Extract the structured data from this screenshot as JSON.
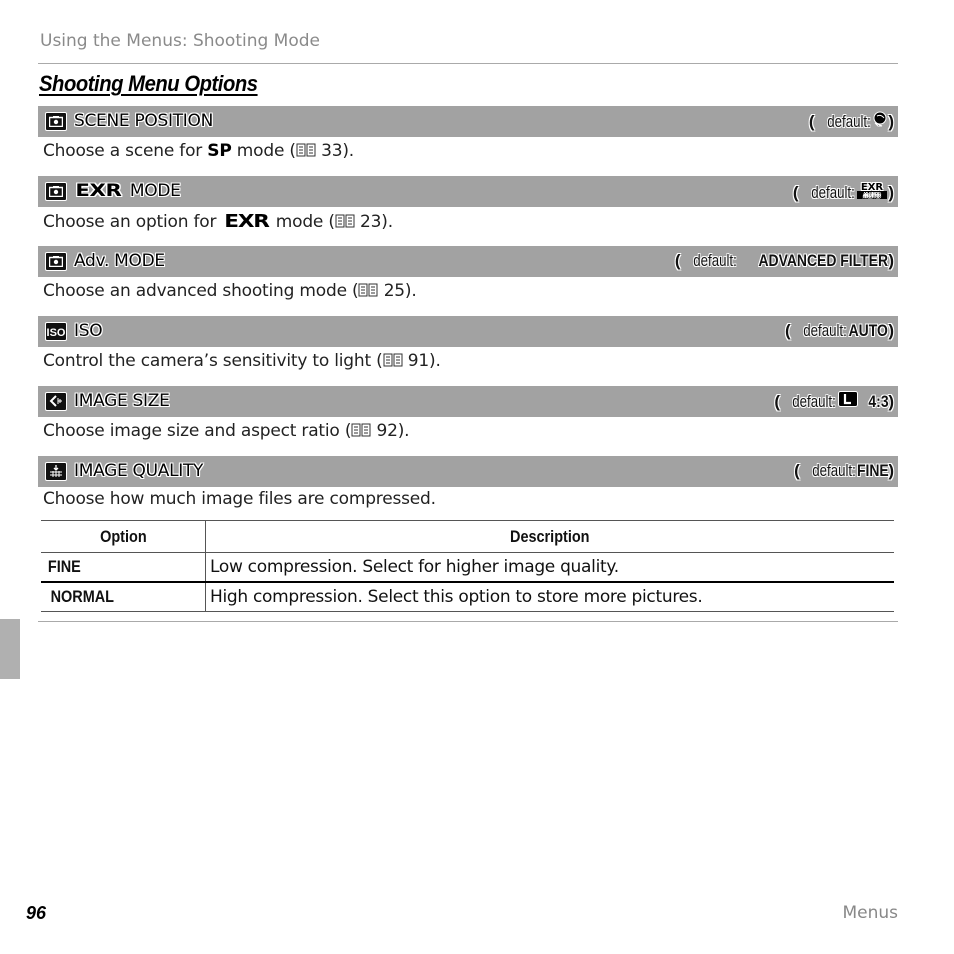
{
  "header": {
    "running_head": "Using the Menus: Shooting Mode"
  },
  "section_title": "Shooting Menu Options",
  "default_prefix": "default: ",
  "items": [
    {
      "icon": "camera-icon",
      "label": "SCENE POSITION",
      "default_value": "",
      "default_icon": "portrait-scene-icon",
      "description_pre": "Choose a scene for ",
      "description_bold": "SP",
      "description_post": " mode (",
      "page_ref": "33",
      "description_end": ")."
    },
    {
      "icon": "camera-icon",
      "label": "MODE",
      "label_prefix_logo": "EXR",
      "default_value": "",
      "default_icon": "exr-auto-icon",
      "description_pre": "Choose an option for ",
      "description_bold": "EXR",
      "description_post": " mode (",
      "page_ref": "23",
      "description_end": ")."
    },
    {
      "icon": "camera-icon",
      "label": "Adv. MODE",
      "default_value": "ADVANCED FILTER",
      "description_pre": "Choose an advanced shooting mode (",
      "page_ref": "25",
      "description_end": ")."
    },
    {
      "icon": "iso-icon",
      "label": "ISO",
      "default_value": "AUTO",
      "description_pre": "Control the camera’s sensitivity to light (",
      "page_ref": "91",
      "description_end": ")."
    },
    {
      "icon": "image-size-icon",
      "label": "IMAGE SIZE",
      "default_value": "4:3",
      "default_icon": "large-size-icon",
      "description_pre": "Choose image size and aspect ratio (",
      "page_ref": "92",
      "description_end": ")."
    },
    {
      "icon": "image-quality-icon",
      "label": "IMAGE QUALITY",
      "default_value": "FINE",
      "description_pre": "Choose how much image files are compressed."
    }
  ],
  "table": {
    "headers": [
      "Option",
      "Description"
    ],
    "rows": [
      {
        "option": "FINE",
        "description": "Low compression.  Select for higher image quality."
      },
      {
        "option": "NORMAL",
        "description": "High compression.  Select this option to store more pictures."
      }
    ]
  },
  "footer": {
    "page_number": "96",
    "section": "Menus"
  },
  "colors": {
    "bar": "#a2a2a2",
    "rule": "#aaaaaa",
    "side_tab": "#b0b0b0"
  }
}
